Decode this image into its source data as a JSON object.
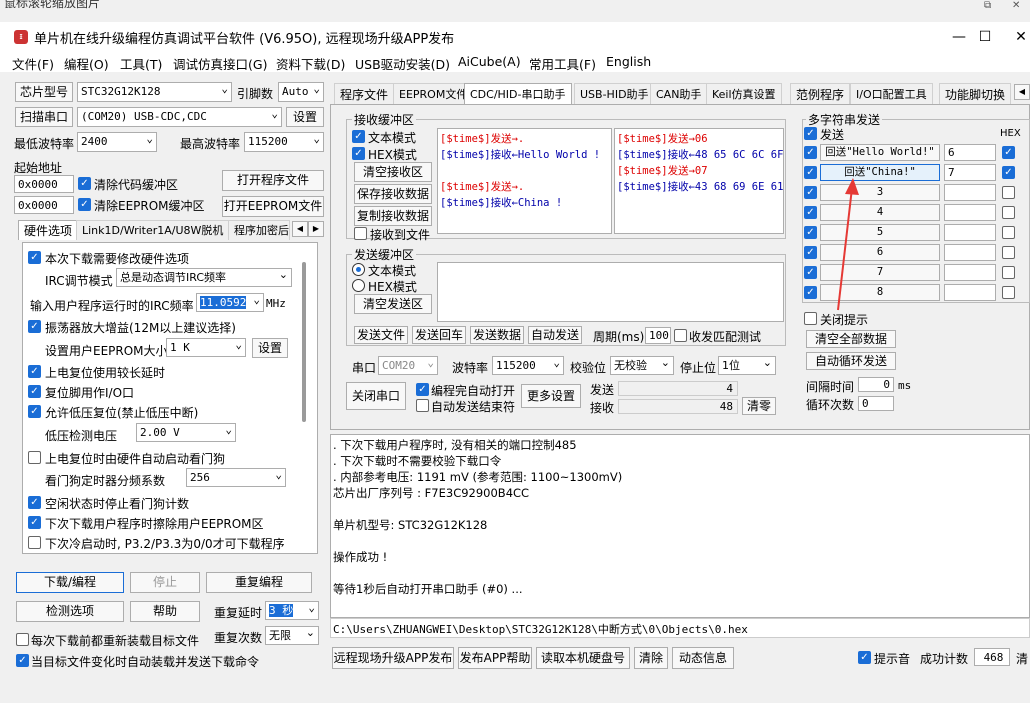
{
  "caption": "鼠标滚轮缩放图片",
  "window": {
    "title": "单片机在线升级编程仿真调试平台软件 (V6.95O), 远程现场升级APP发布",
    "minimize": "—",
    "maximize": "☐",
    "close": "✕"
  },
  "menu": [
    "文件(F)",
    "编程(O)",
    "工具(T)",
    "调试仿真接口(G)",
    "资料下载(D)",
    "USB驱动安装(D)",
    "AiCube(A)",
    "常用工具(F)",
    "English"
  ],
  "left": {
    "chip_btn": "芯片型号",
    "chip_value": "STC32G12K128",
    "pin_label": "引脚数",
    "pin_value": "Auto",
    "scan_btn": "扫描串口",
    "port_value": "(COM20) USB-CDC,CDC",
    "settings_btn": "设置",
    "min_baud_label": "最低波特率",
    "min_baud": "2400",
    "max_baud_label": "最高波特率",
    "max_baud": "115200",
    "start_addr_label": "起始地址",
    "addr1": "0x0000",
    "clear_code": "清除代码缓冲区",
    "open_prog": "打开程序文件",
    "addr2": "0x0000",
    "clear_eeprom": "清除EEPROM缓冲区",
    "open_eeprom": "打开EEPROM文件",
    "tabs": [
      "硬件选项",
      "Link1D/Writer1A/U8W脱机",
      "程序加密后"
    ],
    "options": {
      "opt1": "本次下载需要修改硬件选项",
      "irc_mode_label": "IRC调节模式",
      "irc_mode": "总是动态调节IRC频率",
      "irc_freq_label": "输入用户程序运行时的IRC频率",
      "irc_freq": "11.0592",
      "irc_unit": "MHz",
      "opt2": "振荡器放大增益(12M以上建议选择)",
      "eeprom_size_label": "设置用户EEPROM大小",
      "eeprom_size": "1  K",
      "eeprom_settings": "设置",
      "opt3": "上电复位使用较长延时",
      "opt4": "复位脚用作I/O口",
      "opt5": "允许低压复位(禁止低压中断)",
      "low_volt_label": "低压检测电压",
      "low_volt": "2.00 V",
      "opt6": "上电复位时由硬件自动启动看门狗",
      "wdt_label": "看门狗定时器分频系数",
      "wdt": "256",
      "opt7": "空闲状态时停止看门狗计数",
      "opt8": "下次下载用户程序时擦除用户EEPROM区",
      "opt9": "下次冷启动时, P3.2/P3.3为0/0才可下载程序"
    },
    "download_btn": "下载/编程",
    "stop_btn": "停止",
    "reprogram_btn": "重复编程",
    "check_btn": "检测选项",
    "help_btn": "帮助",
    "repeat_delay_label": "重复延时",
    "repeat_delay": "3 秒",
    "reload_label": "每次下载前都重新装载目标文件",
    "repeat_count_label": "重复次数",
    "repeat_count": "无限",
    "auto_reload_label": "当目标文件变化时自动装载并发送下载命令"
  },
  "main_tabs": [
    "程序文件",
    "EEPROM文件",
    "CDC/HID-串口助手",
    "USB-HID助手",
    "CAN助手",
    "Keil仿真设置",
    "范例程序",
    "I/O口配置工具",
    "功能脚切换"
  ],
  "recv": {
    "title": "接收缓冲区",
    "text_mode": "文本模式",
    "hex_mode": "HEX模式",
    "clear": "清空接收区",
    "save": "保存接收数据",
    "copy": "复制接收数据",
    "to_file": "接收到文件",
    "text_lines": [
      {
        "text": "[$time$]发送→.",
        "color": "red"
      },
      {
        "text": "[$time$]接收←Hello World !",
        "color": "blue"
      },
      {
        "text": "",
        "color": "blue"
      },
      {
        "text": "[$time$]发送→.",
        "color": "red"
      },
      {
        "text": "[$time$]接收←China !",
        "color": "blue"
      }
    ],
    "hex_lines": [
      {
        "text": "[$time$]发送→06",
        "color": "red"
      },
      {
        "text": "[$time$]接收←48 65 6C 6C 6F",
        "color": "blue"
      },
      {
        "text": "[$time$]发送→07",
        "color": "red"
      },
      {
        "text": "[$time$]接收←43 68 69 6E 61",
        "color": "blue"
      }
    ]
  },
  "send": {
    "title": "发送缓冲区",
    "text_mode": "文本模式",
    "hex_mode": "HEX模式",
    "clear": "清空发送区",
    "buttons": [
      "发送文件",
      "发送回车",
      "发送数据",
      "自动发送"
    ],
    "period_label": "周期(ms)",
    "period": "100",
    "match_label": "收发匹配测试"
  },
  "serial": {
    "port_label": "串口",
    "port": "COM20",
    "baud_label": "波特率",
    "baud": "115200",
    "parity_label": "校验位",
    "parity": "无校验",
    "stop_label": "停止位",
    "stop": "1位",
    "close_btn": "关闭串口",
    "auto_open": "编程完自动打开",
    "auto_send_end": "自动发送结束符",
    "more_settings": "更多设置",
    "sent_label": "发送",
    "sent": "4",
    "recv_label": "接收",
    "recv": "48",
    "clear_count": "清零"
  },
  "multi": {
    "title": "多字符串发送",
    "send_label": "发送",
    "hex_label": "HEX",
    "rows": [
      {
        "label": "回送\"Hello World!\"",
        "value": "6"
      },
      {
        "label": "回送\"China!\"",
        "value": "7"
      },
      {
        "label": "3",
        "value": ""
      },
      {
        "label": "4",
        "value": ""
      },
      {
        "label": "5",
        "value": ""
      },
      {
        "label": "6",
        "value": ""
      },
      {
        "label": "7",
        "value": ""
      },
      {
        "label": "8",
        "value": ""
      }
    ],
    "close_tip": "关闭提示",
    "clear_all": "清空全部数据",
    "auto_loop": "自动循环发送",
    "interval_label": "间隔时间",
    "interval": "0",
    "interval_unit": "ms",
    "loop_label": "循环次数",
    "loop": "0"
  },
  "log": [
    "  . 下次下载用户程序时, 没有相关的端口控制485",
    "  . 下次下载时不需要校验下载口令",
    "  . 内部参考电压: 1191 mV (参考范围: 1100~1300mV)",
    "芯片出厂序列号 : F7E3C92900B4CC",
    "",
    "  单片机型号: STC32G12K128",
    "",
    "操作成功 !",
    "",
    "等待1秒后自动打开串口助手 (#0) ..."
  ],
  "path": "C:\\Users\\ZHUANGWEI\\Desktop\\STC32G12K128\\中断方式\\0\\Objects\\0.hex",
  "bottom": {
    "remote": "远程现场升级APP发布",
    "publish_help": "发布APP帮助",
    "read_disk": "读取本机硬盘号",
    "clear": "清除",
    "dynamic": "动态信息",
    "sound": "提示音",
    "success_label": "成功计数",
    "success": "468",
    "clear_trunc": "清"
  },
  "colors": {
    "accent": "#1a6dd6",
    "arrow": "#e53935"
  }
}
